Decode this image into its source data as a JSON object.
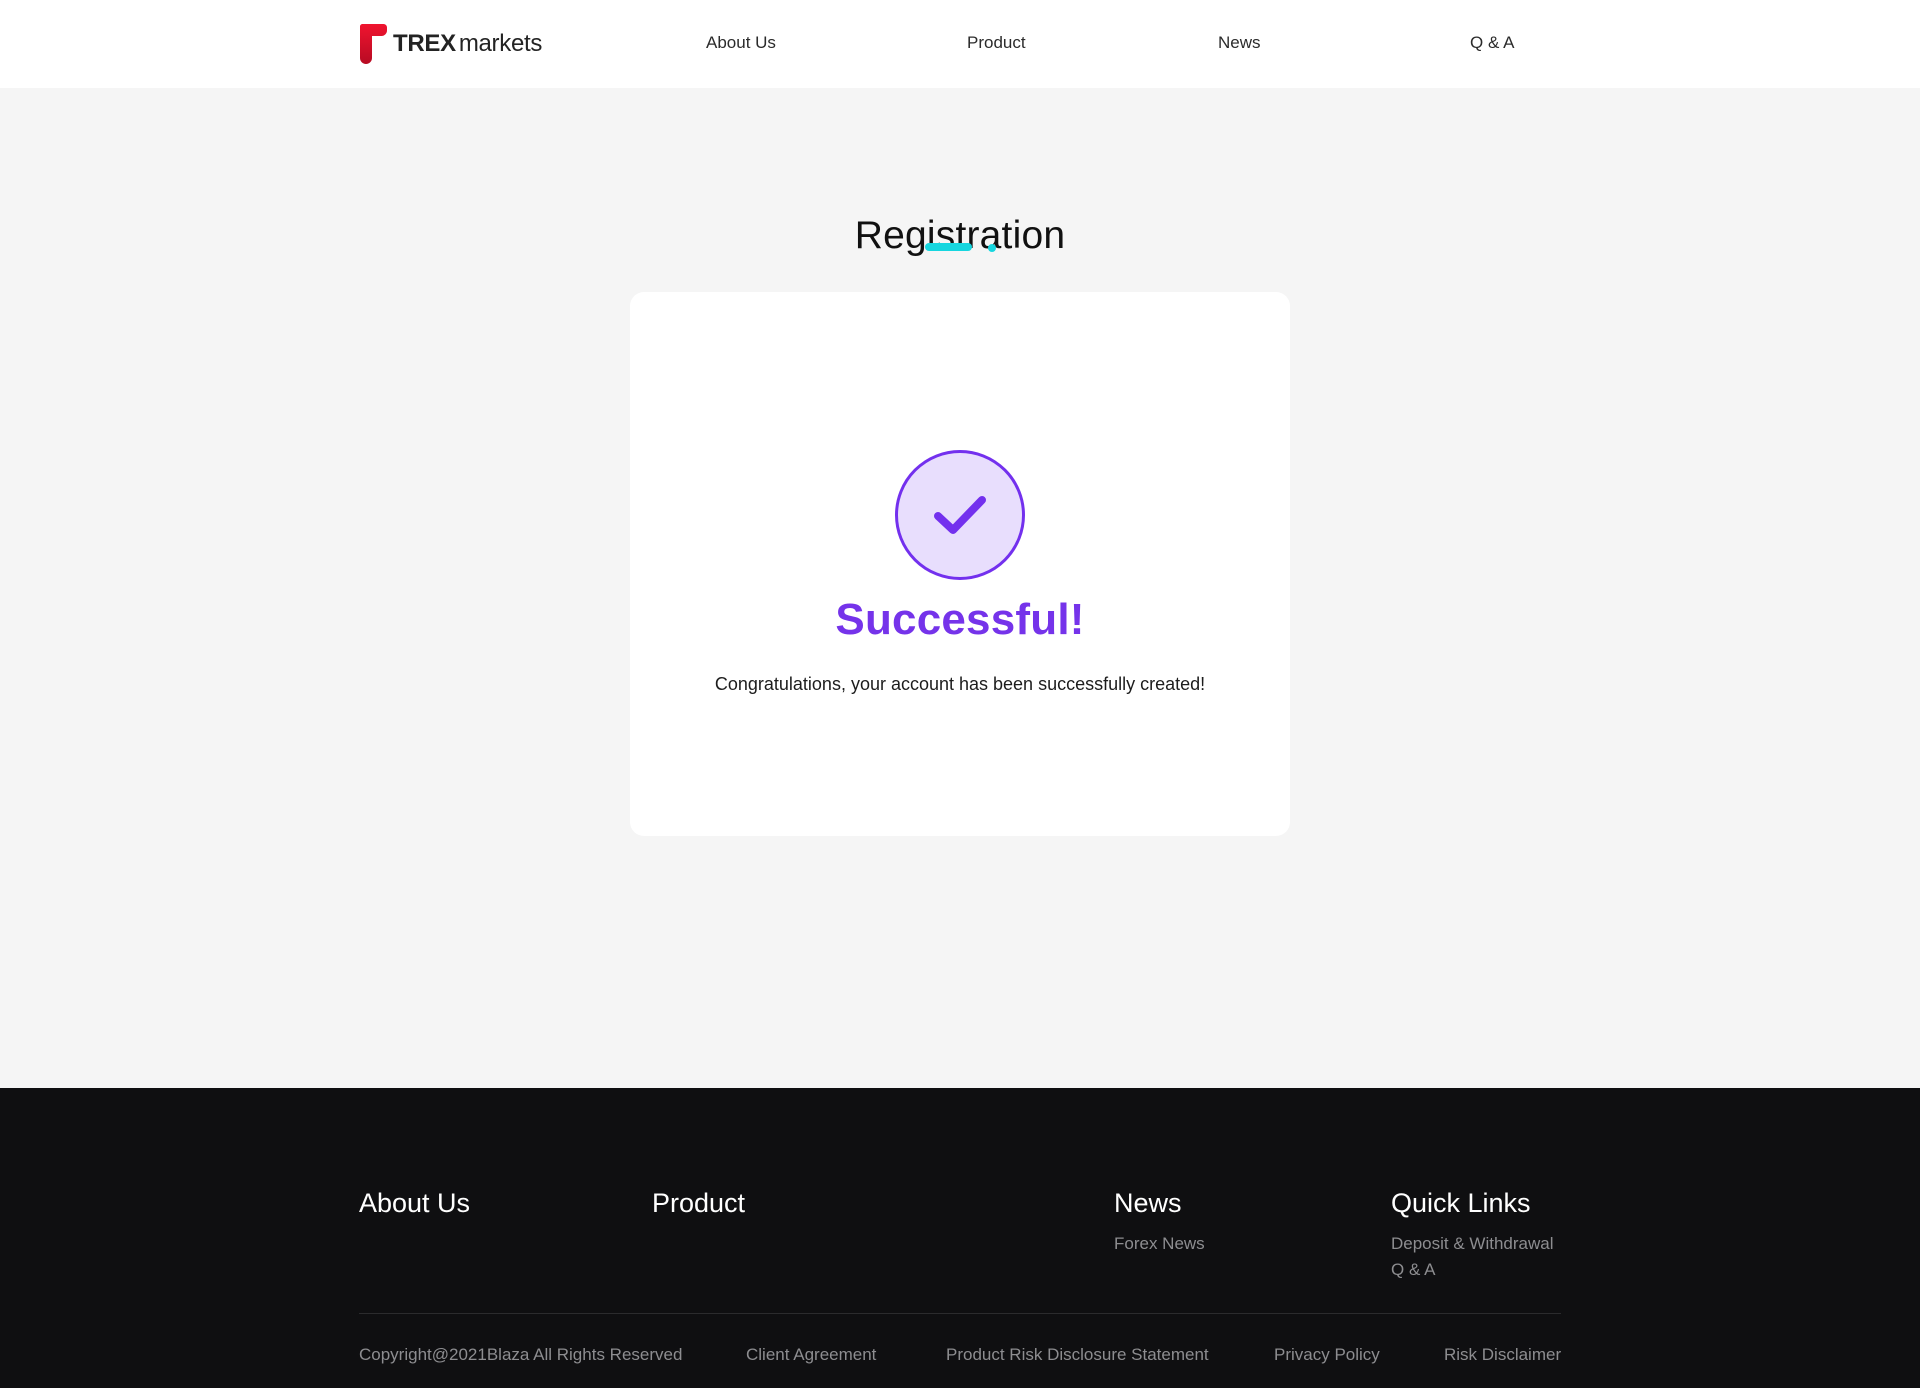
{
  "header": {
    "logo": {
      "brand": "TREX",
      "suffix": "markets",
      "icon": "trex-logo-icon"
    },
    "nav": [
      {
        "label": "About Us"
      },
      {
        "label": "Product"
      },
      {
        "label": "News"
      },
      {
        "label": "Q & A"
      }
    ]
  },
  "registration": {
    "title": "Registration",
    "accent_color": "#16d6df",
    "success": {
      "icon": "success-check-icon",
      "title": "Successful!",
      "message": "Congratulations, your account has been successfully created!",
      "color": "#7330ee",
      "icon_background": "#e8defd"
    }
  },
  "footer": {
    "sections": {
      "about": {
        "heading": "About Us"
      },
      "product": {
        "heading": "Product"
      },
      "news": {
        "heading": "News",
        "links": [
          {
            "label": "Forex News"
          }
        ]
      },
      "quick_links": {
        "heading": "Quick Links",
        "links": [
          {
            "label": "Deposit & Withdrawal"
          },
          {
            "label": "Q & A"
          }
        ]
      }
    },
    "copyright": "Copyright@2021Blaza All Rights Reserved",
    "legal_links": [
      {
        "label": "Client Agreement"
      },
      {
        "label": "Product Risk Disclosure Statement"
      },
      {
        "label": "Privacy Policy"
      },
      {
        "label": "Risk Disclaimer"
      }
    ]
  },
  "colors": {
    "page_background": "#f5f5f5",
    "header_background": "#ffffff",
    "footer_background": "#0f0f11",
    "logo_red": "#e50f2f"
  }
}
